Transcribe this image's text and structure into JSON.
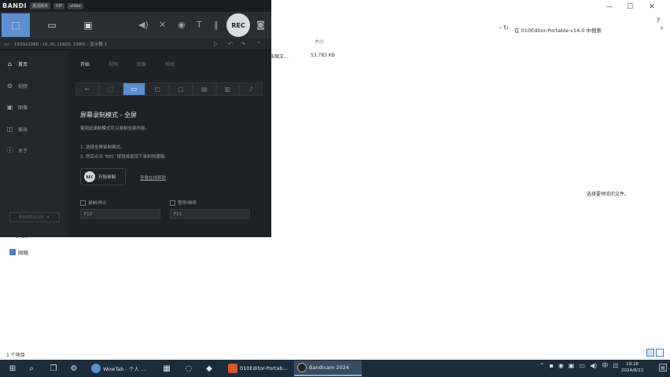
{
  "explorer": {
    "search_placeholder": "在 010Editor-Portable-v14.0 中搜索",
    "column_size_header": "大小",
    "file_type": "压缩文...",
    "file_size": "53,783 KB",
    "preview_text": "选择要预览的文件。",
    "drive_label": "E (E:)",
    "network_label": "网络",
    "item_count": "1 个项目"
  },
  "bandicam": {
    "logo": "BANDI",
    "title_tags": [
      "激活版本",
      "VIP",
      "video"
    ],
    "toolbar_modes": [
      "screen-rect-icon",
      "game-mode-icon",
      "device-mode-icon"
    ],
    "rec_label": "REC",
    "resolution_text": "1920x1080 - (0, 0), (1920, 1080) - 显示器 1",
    "sidebar": [
      {
        "label": "首页",
        "icon": "home-icon",
        "active": true
      },
      {
        "label": "视频",
        "icon": "video-icon",
        "active": false
      },
      {
        "label": "图像",
        "icon": "image-icon",
        "active": false
      },
      {
        "label": "输出",
        "icon": "output-icon",
        "active": false
      },
      {
        "label": "关于",
        "icon": "info-icon",
        "active": false
      }
    ],
    "bandilux": "BANDILUX ✕",
    "tabs": [
      "开始",
      "视频",
      "图像",
      "帮助"
    ],
    "mode_title": "屏幕录制模式 - 全屏",
    "mode_desc": "使用此录制模式可以录制全部内容。",
    "steps": [
      "1. 选择全屏录制模式。",
      "2. 然后点击 'REC' 按钮或者按下录制快捷键。"
    ],
    "start_button": "开始录制",
    "help_link": "查看在线帮助",
    "hotkeys": [
      {
        "label": "录制/停止",
        "value": "F12"
      },
      {
        "label": "暂停/继续",
        "value": "F11"
      }
    ]
  },
  "taskbar": {
    "apps": [
      {
        "label": "WowTab - 个人 ...",
        "active": false
      },
      {
        "label": "010Editor-Portab...",
        "active": false
      },
      {
        "label": "Bandicam 2024",
        "active": true
      }
    ],
    "time": "19:28",
    "date": "2024/8/22",
    "ime": "中"
  }
}
